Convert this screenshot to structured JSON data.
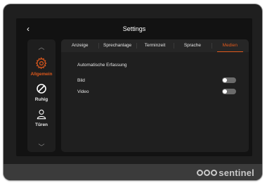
{
  "header": {
    "back_label": "‹",
    "title": "Settings"
  },
  "sidebar": {
    "up_chevron": "︿",
    "down_chevron": "﹀",
    "items": [
      {
        "label": "Allgemein",
        "icon": "gear-icon",
        "active": true
      },
      {
        "label": "Ruhig",
        "icon": "do-not-disturb-icon",
        "active": false
      },
      {
        "label": "Türen",
        "icon": "person-icon",
        "active": false
      }
    ]
  },
  "tabs": [
    {
      "label": "Anzeige",
      "active": false
    },
    {
      "label": "Sprechanlage",
      "active": false
    },
    {
      "label": "Terminzeit",
      "active": false
    },
    {
      "label": "Sprache",
      "active": false
    },
    {
      "label": "Medien",
      "active": true
    }
  ],
  "media": {
    "section_title": "Automatische Erfassung",
    "rows": [
      {
        "label": "Bild",
        "enabled": false
      },
      {
        "label": "Video",
        "enabled": false
      }
    ]
  },
  "brand": {
    "name": "sentinel"
  },
  "colors": {
    "accent": "#e0591c",
    "background": "#121212",
    "panel": "#1f1f1f"
  }
}
